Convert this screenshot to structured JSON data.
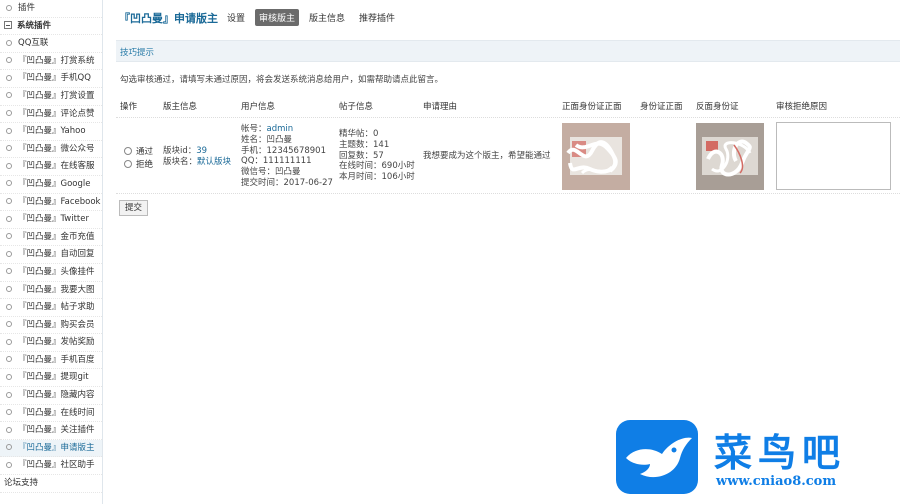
{
  "sidebar": {
    "items": [
      {
        "label": "插件",
        "kind": "plain"
      },
      {
        "label": "系统插件",
        "kind": "cat"
      },
      {
        "label": "QQ互联",
        "kind": "plain"
      },
      {
        "label": "『凹凸曼』打赏系统",
        "kind": "plain"
      },
      {
        "label": "『凹凸曼』手机QQ",
        "kind": "plain"
      },
      {
        "label": "『凹凸曼』打赏设置",
        "kind": "plain"
      },
      {
        "label": "『凹凸曼』评论点赞",
        "kind": "plain"
      },
      {
        "label": "『凹凸曼』Yahoo",
        "kind": "plain"
      },
      {
        "label": "『凹凸曼』微公众号",
        "kind": "plain"
      },
      {
        "label": "『凹凸曼』在线客服",
        "kind": "plain"
      },
      {
        "label": "『凹凸曼』Google",
        "kind": "plain"
      },
      {
        "label": "『凹凸曼』Facebook",
        "kind": "plain"
      },
      {
        "label": "『凹凸曼』Twitter",
        "kind": "plain"
      },
      {
        "label": "『凹凸曼』金币充值",
        "kind": "plain"
      },
      {
        "label": "『凹凸曼』自动回复",
        "kind": "plain"
      },
      {
        "label": "『凹凸曼』头像挂件",
        "kind": "plain"
      },
      {
        "label": "『凹凸曼』我要大图",
        "kind": "plain"
      },
      {
        "label": "『凹凸曼』帖子求助",
        "kind": "plain"
      },
      {
        "label": "『凹凸曼』购买会员",
        "kind": "plain"
      },
      {
        "label": "『凹凸曼』发帖奖励",
        "kind": "plain"
      },
      {
        "label": "『凹凸曼』手机百度",
        "kind": "plain"
      },
      {
        "label": "『凹凸曼』提现git",
        "kind": "plain"
      },
      {
        "label": "『凹凸曼』隐藏内容",
        "kind": "plain"
      },
      {
        "label": "『凹凸曼』在线时间",
        "kind": "plain"
      },
      {
        "label": "『凹凸曼』关注插件",
        "kind": "plain"
      },
      {
        "label": "『凹凸曼』申请版主",
        "kind": "active"
      },
      {
        "label": "『凹凸曼』社区助手",
        "kind": "plain"
      },
      {
        "label": "论坛支持",
        "kind": "sub"
      }
    ]
  },
  "header": {
    "brand": "『凹凸曼』申请版主",
    "nav": [
      {
        "label": "设置",
        "active": false
      },
      {
        "label": "审核版主",
        "active": true
      },
      {
        "label": "版主信息",
        "active": false
      },
      {
        "label": "推荐插件",
        "active": false
      }
    ]
  },
  "section": {
    "title": "技巧提示"
  },
  "notice": "勾选审核通过，请填写未通过原因，将会发送系统消息给用户，如需帮助请点此留言。",
  "table": {
    "headers": [
      "操作",
      "版主信息",
      "用户信息",
      "帖子信息",
      "申请理由",
      "正面身份证正面",
      "身份证正面",
      "反面身份证",
      "审核拒绝原因"
    ],
    "row": {
      "approve_label": "通过",
      "reject_label": "拒绝",
      "mod_info": {
        "forum_id_label": "版块id：",
        "forum_id": "39",
        "forum_name_label": "版块名：",
        "forum_name": "默认版块"
      },
      "user_info": {
        "account_label": "帐号：",
        "account": "admin",
        "name": "姓名：凹凸曼",
        "phone": "手机：12345678901",
        "qq": "QQ：111111111",
        "wechat": "微信号：凹凸曼",
        "submit_time": "提交时间：2017-06-27"
      },
      "post_info": {
        "digest": "精华帖：0",
        "threads": "主题数：141",
        "posts": "回复数：57",
        "online": "在线时间：690小时",
        "month_online": "本月时间：106小时"
      },
      "reason": "我想要成为这个版主，希望能通过"
    }
  },
  "submit_label": "提交",
  "watermark": {
    "title": "菜鸟吧",
    "url": "www.cniao8.com"
  },
  "colors": {
    "accent": "#1b6a98",
    "watermark": "#0f7ee6"
  }
}
